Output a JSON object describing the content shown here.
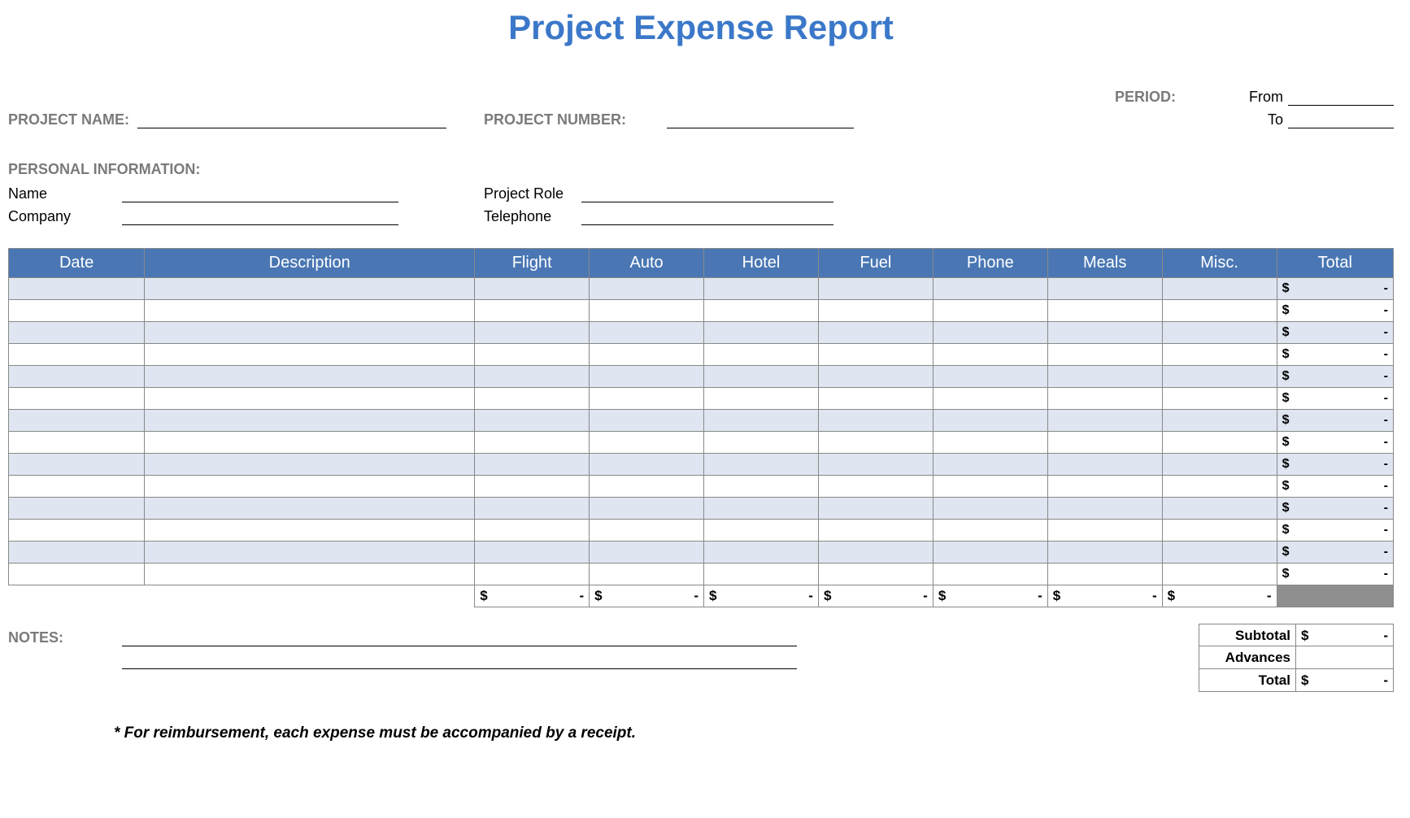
{
  "title": "Project Expense Report",
  "header": {
    "project_name_label": "PROJECT NAME:",
    "project_number_label": "PROJECT NUMBER:",
    "period_label": "PERIOD:",
    "from_label": "From",
    "to_label": "To"
  },
  "personal": {
    "section_label": "PERSONAL INFORMATION:",
    "name_label": "Name",
    "company_label": "Company",
    "project_role_label": "Project Role",
    "telephone_label": "Telephone"
  },
  "table": {
    "columns": [
      "Date",
      "Description",
      "Flight",
      "Auto",
      "Hotel",
      "Fuel",
      "Phone",
      "Meals",
      "Misc.",
      "Total"
    ],
    "rows": 14,
    "row_total_symbol": "$",
    "row_total_value": "-",
    "column_totals": [
      {
        "symbol": "$",
        "value": "-"
      },
      {
        "symbol": "$",
        "value": "-"
      },
      {
        "symbol": "$",
        "value": "-"
      },
      {
        "symbol": "$",
        "value": "-"
      },
      {
        "symbol": "$",
        "value": "-"
      },
      {
        "symbol": "$",
        "value": "-"
      },
      {
        "symbol": "$",
        "value": "-"
      }
    ]
  },
  "summary": {
    "subtotal_label": "Subtotal",
    "subtotal_symbol": "$",
    "subtotal_value": "-",
    "advances_label": "Advances",
    "total_label": "Total",
    "total_symbol": "$",
    "total_value": "-"
  },
  "notes": {
    "label": "NOTES:"
  },
  "footnote": "* For reimbursement, each expense must be accompanied by a receipt."
}
